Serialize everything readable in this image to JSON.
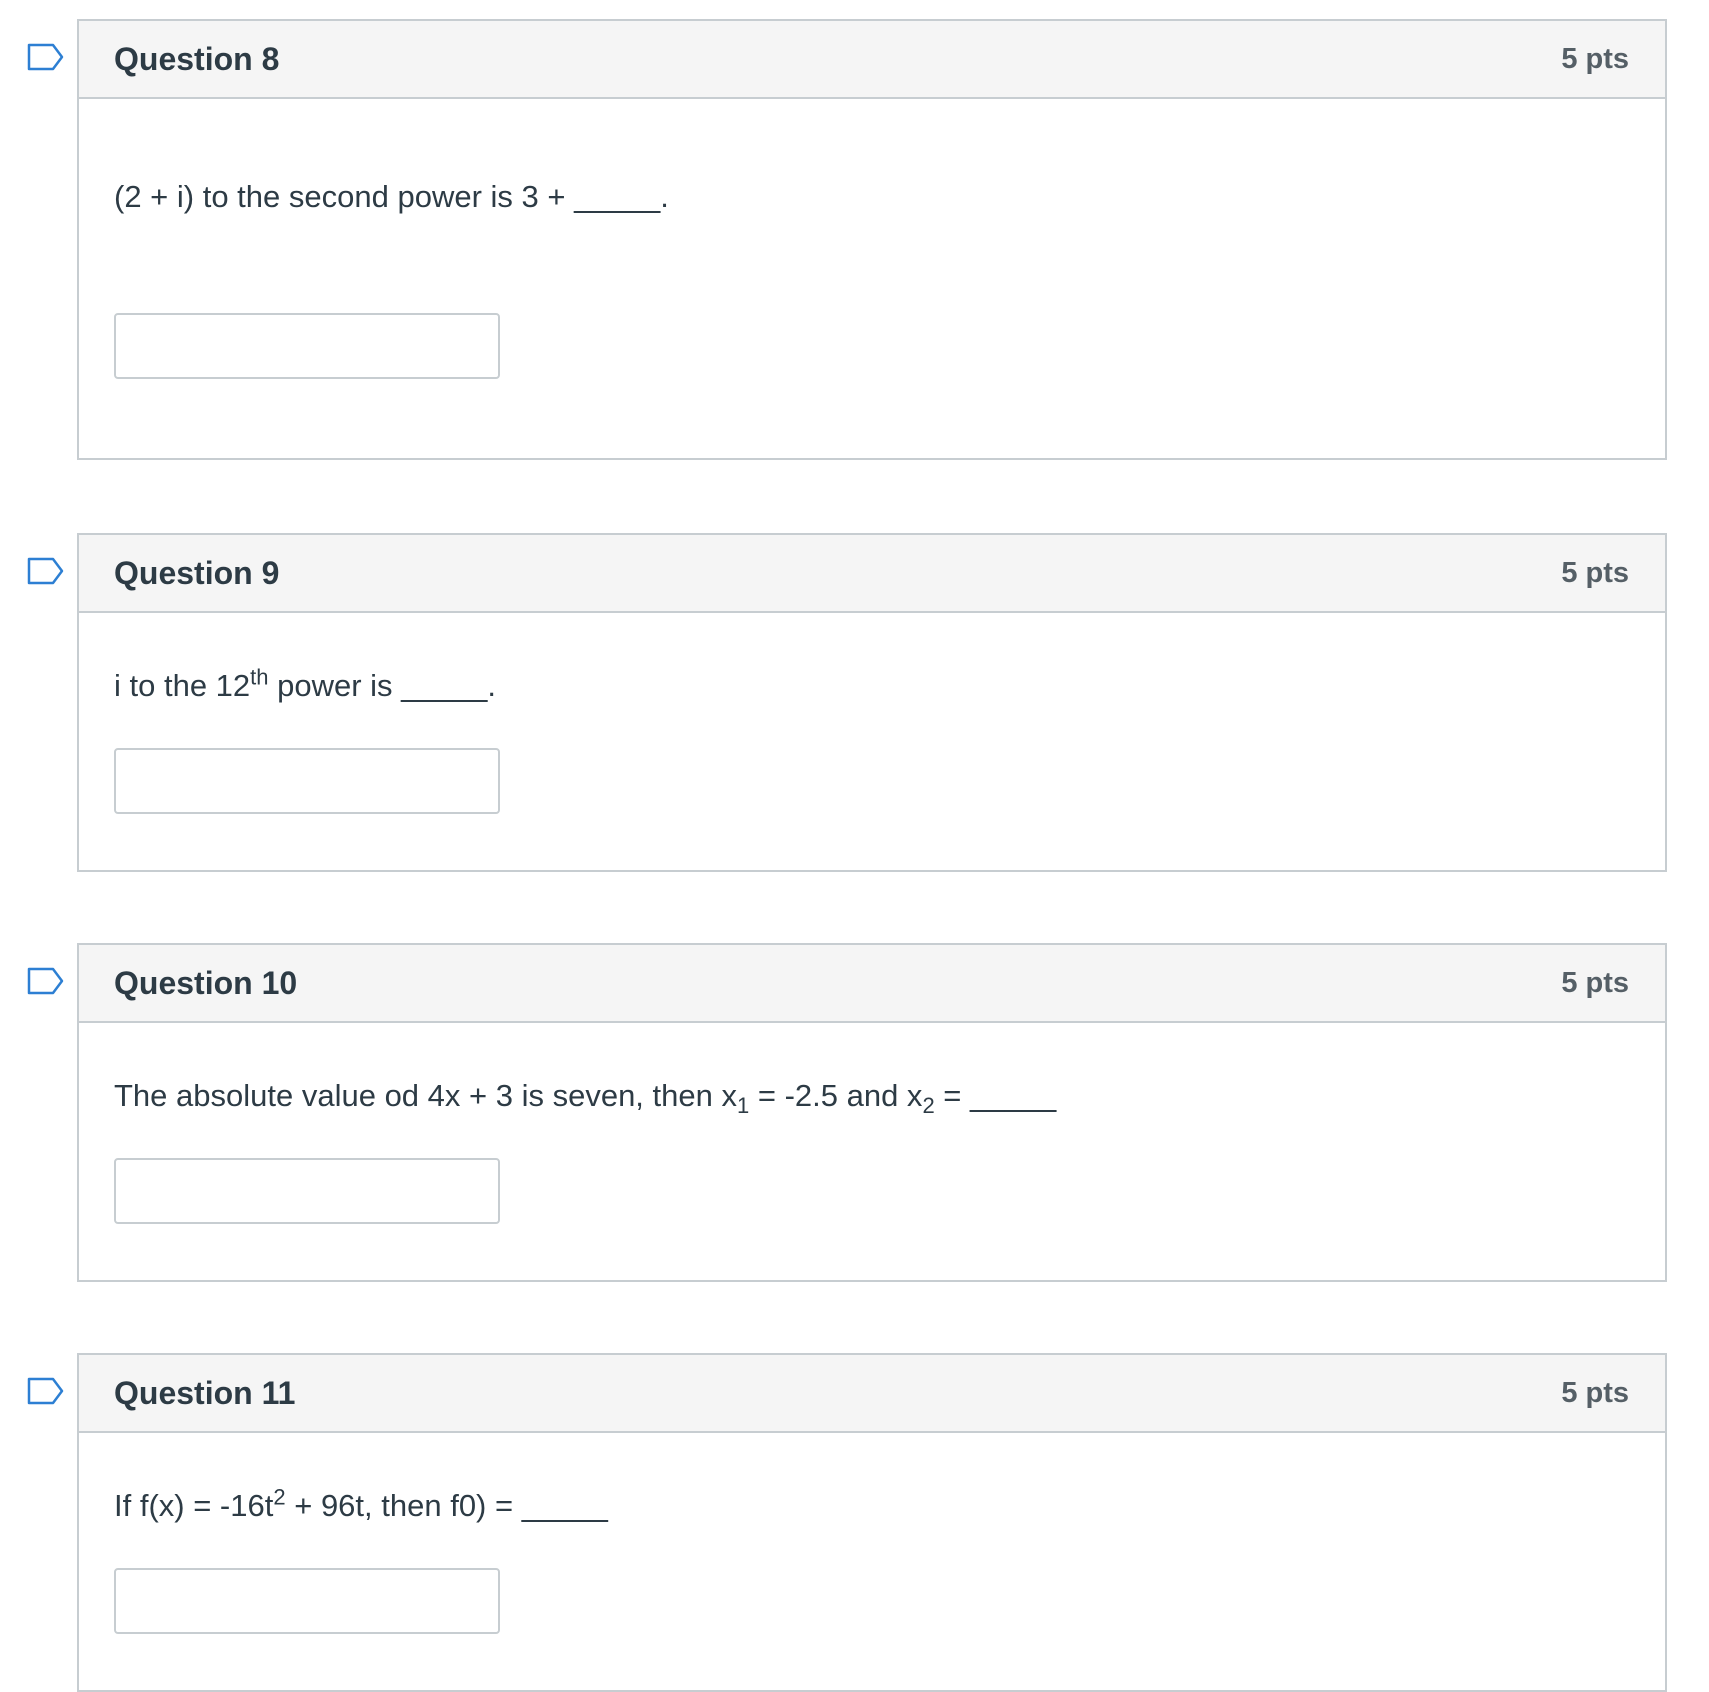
{
  "questions": [
    {
      "title": "Question 8",
      "points": "5 pts",
      "text": {
        "pre": "(2 + i) to the second power is 3 + _____."
      },
      "answer": ""
    },
    {
      "title": "Question 9",
      "points": "5 pts",
      "text": {
        "pre": "i to the 12",
        "sup": "th",
        "post": " power is _____."
      },
      "answer": ""
    },
    {
      "title": "Question 10",
      "points": "5 pts",
      "text": {
        "pre": "The absolute value od 4x + 3 is seven, then x",
        "sub1": "1",
        "mid": " = -2.5 and x",
        "sub2": "2",
        "post": " = _____"
      },
      "answer": ""
    },
    {
      "title": "Question 11",
      "points": "5 pts",
      "text": {
        "pre": "If f(x) = -16t",
        "sup": "2",
        "post": " + 96t, then f0) = _____"
      },
      "answer": ""
    }
  ],
  "colors": {
    "border": "#c7cdd1",
    "header_bg": "#f5f5f5",
    "title_text": "#2d3b45",
    "points_text": "#555f66",
    "flag_stroke": "#2d7fd3"
  },
  "icons": {
    "flag": "bookmark-flag-icon"
  }
}
